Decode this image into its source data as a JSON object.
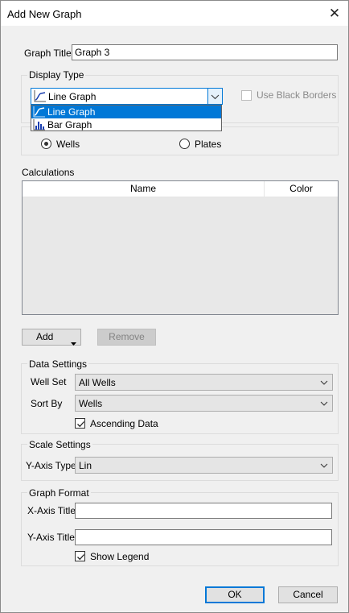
{
  "window": {
    "title": "Add New Graph",
    "close_glyph": "✕"
  },
  "graph_title": {
    "label": "Graph Title",
    "value": "Graph 3"
  },
  "display_type": {
    "group_label": "Display Type",
    "selected": "Line Graph",
    "options": [
      "Line Graph",
      "Bar Graph"
    ],
    "use_black_borders_label": "Use Black Borders",
    "use_black_borders_checked": false
  },
  "source": {
    "wells_label": "Wells",
    "plates_label": "Plates",
    "selected": "Wells"
  },
  "calculations": {
    "label": "Calculations",
    "columns": [
      "Name",
      "Color"
    ],
    "rows": [],
    "add_label": "Add",
    "remove_label": "Remove"
  },
  "data_settings": {
    "group_label": "Data Settings",
    "well_set_label": "Well Set",
    "well_set_value": "All Wells",
    "sort_by_label": "Sort By",
    "sort_by_value": "Wells",
    "ascending_label": "Ascending Data",
    "ascending_checked": true
  },
  "scale_settings": {
    "group_label": "Scale Settings",
    "y_axis_type_label": "Y-Axis Type",
    "y_axis_type_value": "Lin"
  },
  "graph_format": {
    "group_label": "Graph Format",
    "x_axis_title_label": "X-Axis Title",
    "x_axis_title_value": "",
    "y_axis_title_label": "Y-Axis Title",
    "y_axis_title_value": "",
    "show_legend_label": "Show Legend",
    "show_legend_checked": true
  },
  "footer": {
    "ok_label": "OK",
    "cancel_label": "Cancel"
  },
  "colors": {
    "accent": "#0078d7",
    "dialog_bg": "#f0f0f0",
    "edge": "#7a1a1a"
  }
}
